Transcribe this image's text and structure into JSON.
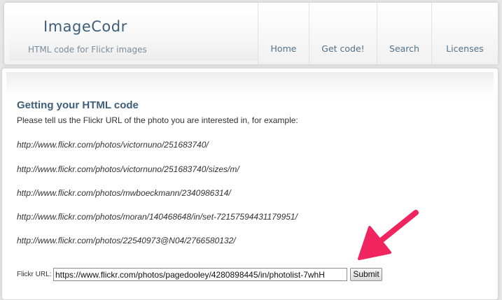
{
  "header": {
    "title": "ImageCodr",
    "tagline": "HTML code for Flickr images",
    "nav": [
      {
        "label": "Home"
      },
      {
        "label": "Get code!"
      },
      {
        "label": "Search"
      },
      {
        "label": "Licenses"
      }
    ]
  },
  "main": {
    "heading": "Getting your HTML code",
    "intro": "Please tell us the Flickr URL of the photo you are interested in, for example:",
    "examples": [
      "http://www.flickr.com/photos/victornuno/251683740/",
      "http://www.flickr.com/photos/victornuno/251683740/sizes/m/",
      "http://www.flickr.com/photos/mwboeckmann/2340986314/",
      "http://www.flickr.com/photos/moran/140468648/in/set-72157594431179951/",
      "http://www.flickr.com/photos/22540973@N04/2766580132/"
    ],
    "form": {
      "label": "Flickr URL:",
      "value": "https://www.flickr.com/photos/pagedooley/4280898445/in/photolist-7whH",
      "submit_label": "Submit"
    }
  },
  "colors": {
    "title": "#3e5e79",
    "nav_text": "#51708a",
    "arrow": "#f0245f"
  },
  "icons": {
    "annotation": "arrow-icon"
  }
}
